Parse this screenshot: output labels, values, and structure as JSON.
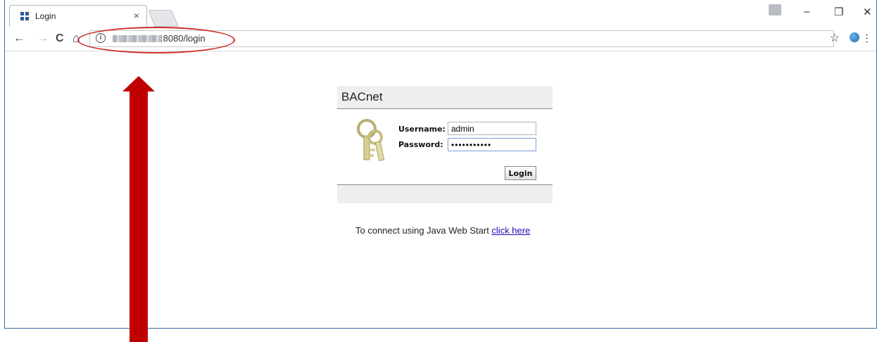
{
  "tab": {
    "title": "Login",
    "close": "×"
  },
  "window_controls": {
    "minimize": "–",
    "restore": "❐",
    "close": "✕"
  },
  "toolbar": {
    "back": "←",
    "forward": "→",
    "reload": "C",
    "home": "⌂",
    "info": "i",
    "url_suffix": ":8080/login",
    "star": "☆",
    "menu": "⋮"
  },
  "login_panel": {
    "title": "BACnet",
    "username_label": "Username:",
    "username_value": "admin",
    "password_label": "Password:",
    "password_value": "•••••••••••",
    "login_button": "Login"
  },
  "java_web_start": {
    "text": "To connect using Java Web Start ",
    "link": "click here"
  },
  "colors": {
    "annotation_red": "#c00000",
    "window_border": "#3b6ea8"
  }
}
